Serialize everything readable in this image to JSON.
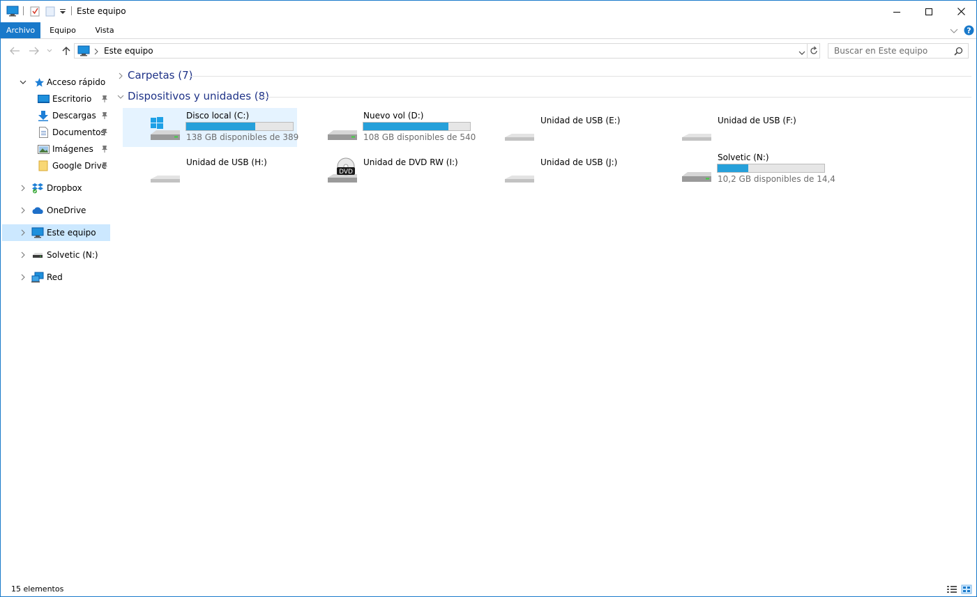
{
  "window": {
    "title": "Este equipo"
  },
  "ribbon": {
    "tabs": [
      {
        "label": "Archivo"
      },
      {
        "label": "Equipo"
      },
      {
        "label": "Vista"
      }
    ]
  },
  "address": {
    "path": "Este equipo"
  },
  "search": {
    "placeholder": "Buscar en Este equipo"
  },
  "nav": {
    "quick_access": "Acceso rápido",
    "pinned": [
      {
        "label": "Escritorio",
        "icon": "desktop-icon"
      },
      {
        "label": "Descargas",
        "icon": "download-icon"
      },
      {
        "label": "Documentos",
        "icon": "document-icon"
      },
      {
        "label": "Imágenes",
        "icon": "pictures-icon"
      },
      {
        "label": "Google Drive",
        "icon": "folder-icon"
      }
    ],
    "dropbox": "Dropbox",
    "onedrive": "OneDrive",
    "this_pc": "Este equipo",
    "solvetic": "Solvetic (N:)",
    "network": "Red"
  },
  "groups": {
    "folders": "Carpetas (7)",
    "devices": "Dispositivos y unidades (8)"
  },
  "drives": [
    {
      "name": "Disco local (C:)",
      "icon": "windows-drive-icon",
      "free_text": "138 GB disponibles de 389",
      "used_fraction": 0.645,
      "selected": true
    },
    {
      "name": "Nuevo vol (D:)",
      "icon": "hard-drive-icon",
      "free_text": "108 GB disponibles de 540",
      "used_fraction": 0.8
    },
    {
      "name": "Unidad de USB (E:)",
      "icon": "usb-drive-icon"
    },
    {
      "name": "Unidad de USB (F:)",
      "icon": "usb-drive-icon"
    },
    {
      "name": "Unidad de USB (H:)",
      "icon": "usb-drive-icon"
    },
    {
      "name": "Unidad de DVD RW (I:)",
      "icon": "dvd-drive-icon",
      "badge": "DVD"
    },
    {
      "name": "Unidad de USB (J:)",
      "icon": "usb-drive-icon"
    },
    {
      "name": "Solvetic (N:)",
      "icon": "hard-drive-icon",
      "free_text": "10,2 GB disponibles de 14,4",
      "used_fraction": 0.29
    }
  ],
  "status": {
    "count": "15 elementos"
  },
  "colors": {
    "accent": "#1979ca",
    "selection": "#cce8ff",
    "bar_fill": "#26a0da",
    "group_title": "#1e3287"
  }
}
